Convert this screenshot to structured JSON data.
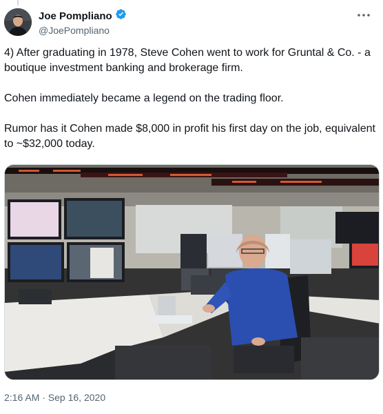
{
  "author": {
    "name": "Joe Pompliano",
    "handle": "@JoePompliano",
    "verified": true,
    "verified_color": "#1d9bf0"
  },
  "tweet": {
    "paragraphs": [
      "4) After graduating in 1978, Steve Cohen went to work for Gruntal & Co. - a boutique investment banking and brokerage firm.",
      "Cohen immediately became a legend on the trading floor.",
      "Rumor has it Cohen made $8,000 in profit his first day on the job, equivalent to ~$32,000 today."
    ]
  },
  "timestamp": "2:16 AM · Sep 16, 2020",
  "icons": {
    "more": "more-horizontal-icon",
    "verified": "verified-badge-icon"
  },
  "colors": {
    "text_primary": "#0f1419",
    "text_secondary": "#536471",
    "brand_blue": "#1d9bf0"
  }
}
